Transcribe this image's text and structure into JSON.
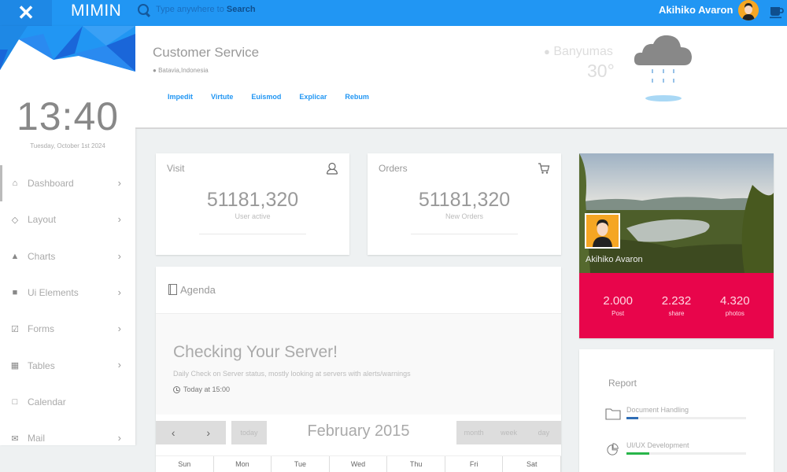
{
  "topbar": {
    "close_icon": "close-icon",
    "brand": "MIMIN",
    "search_placeholder_prefix": "Type anywhere to ",
    "search_placeholder_emph": "Search",
    "user_name": "Akihiko Avaron",
    "cup_icon": "coffee-cup-icon"
  },
  "sidebar": {
    "clock": "13:40",
    "date": "Tuesday, October 1st 2024",
    "items": [
      {
        "label": "Dashboard",
        "icon": "⌂",
        "chevron": true,
        "active": true
      },
      {
        "label": "Layout",
        "icon": "◇",
        "chevron": true
      },
      {
        "label": "Charts",
        "icon": "▲",
        "chevron": true
      },
      {
        "label": "Ui Elements",
        "icon": "■",
        "chevron": true
      },
      {
        "label": "Forms",
        "icon": "☑",
        "chevron": true
      },
      {
        "label": "Tables",
        "icon": "▦",
        "chevron": true
      },
      {
        "label": "Calendar",
        "icon": "□",
        "chevron": false
      },
      {
        "label": "Mail",
        "icon": "✉",
        "chevron": true
      }
    ],
    "chevron_glyph": "›"
  },
  "header": {
    "title": "Customer Service",
    "location": "Batavia,Indonesia",
    "tabs": [
      "Impedit",
      "Virtute",
      "Euismod",
      "Explicar",
      "Rebum"
    ],
    "weather": {
      "city": "Banyumas",
      "temperature": "30°",
      "condition_icon": "rain-cloud-icon"
    }
  },
  "cards": {
    "visit": {
      "title": "Visit",
      "value": "51181,320",
      "subtitle": "User active"
    },
    "orders": {
      "title": "Orders",
      "value": "51181,320",
      "subtitle": "New Orders"
    }
  },
  "agenda": {
    "title": "Agenda",
    "event": {
      "title": "Checking Your Server!",
      "description": "Daily Check on Server status, mostly looking at servers with alerts/warnings",
      "time": "Today at 15:00"
    },
    "calendar": {
      "prev": "‹",
      "next": "›",
      "today": "today",
      "title": "February 2015",
      "views": [
        "month",
        "week",
        "day"
      ],
      "weekdays": [
        "Sun",
        "Mon",
        "Tue",
        "Wed",
        "Thu",
        "Fri",
        "Sat"
      ]
    }
  },
  "profile": {
    "name": "Akihiko Avaron",
    "stats": [
      {
        "value": "2.000",
        "label": "Post"
      },
      {
        "value": "2.232",
        "label": "share"
      },
      {
        "value": "4.320",
        "label": "photos"
      }
    ],
    "accent_color": "#e8054b"
  },
  "report": {
    "title": "Report",
    "items": [
      {
        "label": "Document Handling",
        "progress_percent": 10,
        "color": "#2f6db5",
        "icon": "folder-icon"
      },
      {
        "label": "UI/UX Development",
        "progress_percent": 19,
        "color": "#28b54a",
        "icon": "pie-chart-icon"
      }
    ]
  },
  "colors": {
    "primary": "#2196f3",
    "primary_dark": "#1e88e5"
  }
}
